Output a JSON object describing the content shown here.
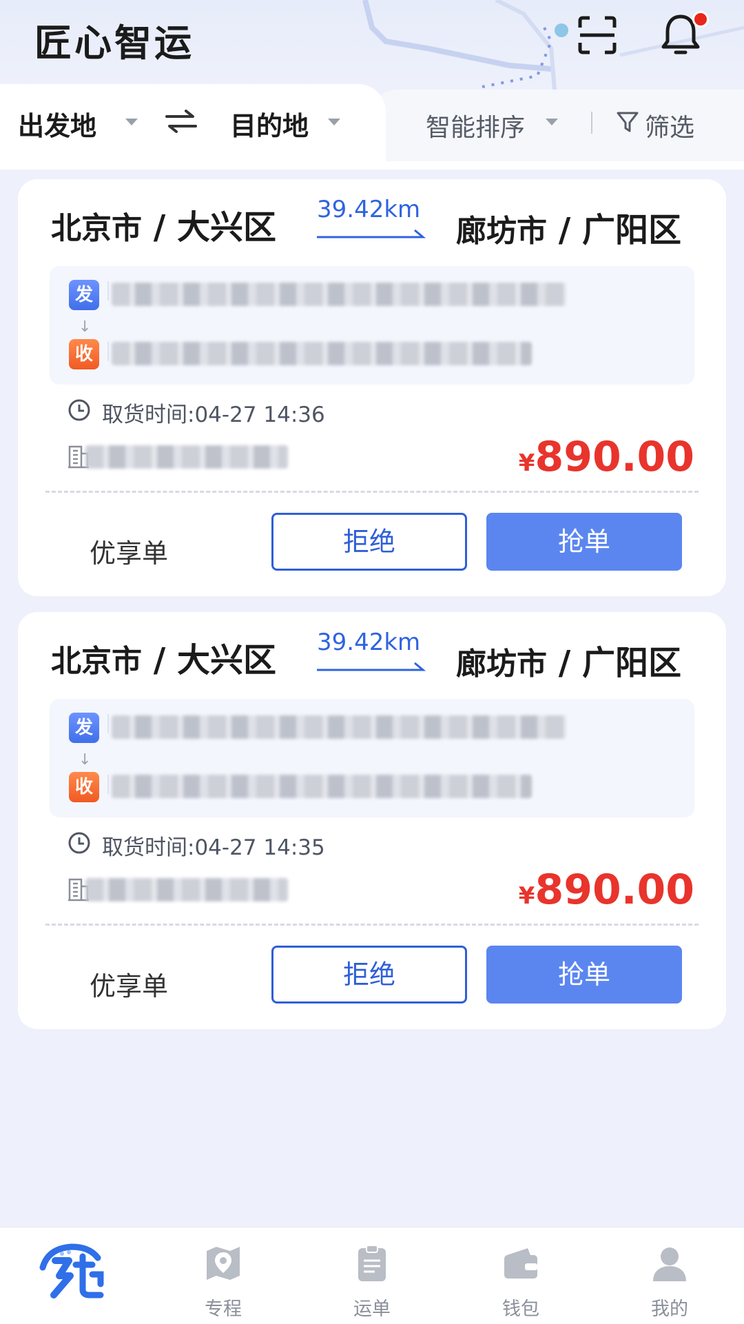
{
  "header": {
    "app_title": "匠心智运",
    "icons": [
      "scan-icon",
      "bell-icon"
    ],
    "has_notification": true
  },
  "filter_bar": {
    "origin_label": "出发地",
    "destination_label": "目的地",
    "sort_label": "智能排序",
    "filter_label": "筛选"
  },
  "orders": [
    {
      "from_city": "北京市",
      "from_district": "大兴区",
      "distance": "39.42km",
      "to_city": "廊坊市",
      "to_district": "广阳区",
      "send_tag": "发",
      "recv_tag": "收",
      "pickup_time": "取货时间:04-27 14:36",
      "currency": "¥",
      "price": "890.00",
      "order_type": "优享单",
      "reject_label": "拒绝",
      "grab_label": "抢单"
    },
    {
      "from_city": "北京市",
      "from_district": "大兴区",
      "distance": "39.42km",
      "to_city": "廊坊市",
      "to_district": "广阳区",
      "send_tag": "发",
      "recv_tag": "收",
      "pickup_time": "取货时间:04-27 14:35",
      "currency": "¥",
      "price": "890.00",
      "order_type": "优享单",
      "reject_label": "拒绝",
      "grab_label": "抢单"
    }
  ],
  "bottom_nav": {
    "items": [
      {
        "label": "",
        "icon": "grab-logo-icon",
        "active": true
      },
      {
        "label": "专程",
        "icon": "map-pin-icon"
      },
      {
        "label": "运单",
        "icon": "clipboard-icon"
      },
      {
        "label": "钱包",
        "icon": "wallet-icon"
      },
      {
        "label": "我的",
        "icon": "user-icon"
      }
    ]
  },
  "colors": {
    "accent": "#5b86f0",
    "accent_dark": "#2f5fd8",
    "price": "#e8342c",
    "send_tag": "#3f6fea",
    "recv_tag": "#f05a23"
  }
}
